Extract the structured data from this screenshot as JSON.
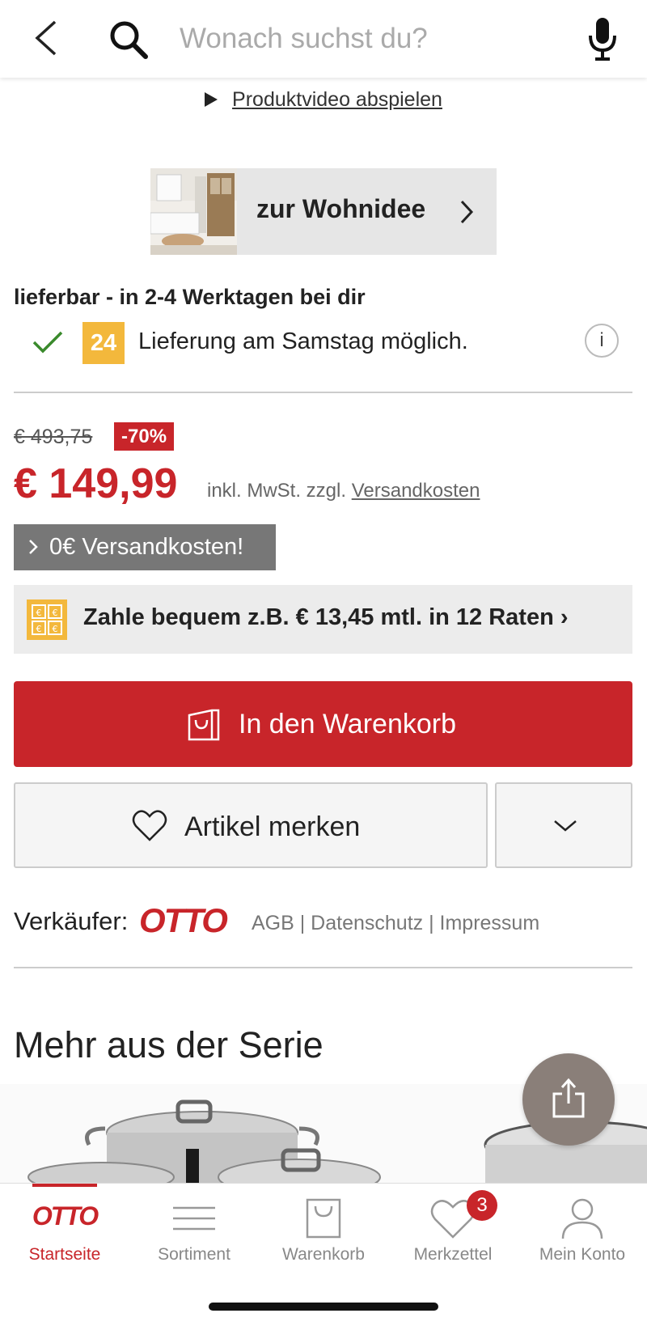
{
  "search": {
    "placeholder": "Wonach suchst du?"
  },
  "video": {
    "label": "Produktvideo abspielen"
  },
  "wohnidee": {
    "label": "zur Wohnidee"
  },
  "delivery": {
    "title": "lieferbar - in 2-4 Werktagen bei dir",
    "badge": "24",
    "saturday": "Lieferung am Samstag möglich.",
    "info": "i"
  },
  "price": {
    "old": "€ 493,75",
    "discount": "-70%",
    "current": "€ 149,99",
    "vat_prefix": "inkl. MwSt. zzgl.",
    "shipping_link": "Versandkosten"
  },
  "free_shipping": "0€ Versandkosten!",
  "installment": "Zahle bequem z.B. € 13,45 mtl. in 12 Raten ›",
  "actions": {
    "cart": "In den Warenkorb",
    "wishlist": "Artikel merken"
  },
  "seller": {
    "label": "Verkäufer:",
    "logo": "OTTO",
    "legal": "AGB | Datenschutz | Impressum"
  },
  "series": {
    "title": "Mehr aus der Serie"
  },
  "tabs": [
    {
      "label": "Startseite",
      "logo": "OTTO"
    },
    {
      "label": "Sortiment"
    },
    {
      "label": "Warenkorb"
    },
    {
      "label": "Merkzettel",
      "badge": "3"
    },
    {
      "label": "Mein Konto"
    }
  ],
  "colors": {
    "brand": "#c8252a",
    "accent_yellow": "#f3b83c"
  }
}
